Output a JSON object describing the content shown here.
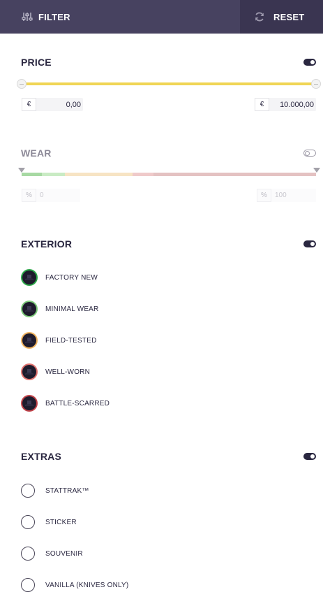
{
  "header": {
    "filter_label": "FILTER",
    "reset_label": "RESET",
    "filter_icon": "sliders-icon",
    "reset_icon": "refresh-icon"
  },
  "price": {
    "title": "PRICE",
    "enabled": true,
    "currency": "€",
    "min_value": "0,00",
    "max_value": "10.000,00",
    "track_color": "#f0d555"
  },
  "wear": {
    "title": "WEAR",
    "enabled": false,
    "percent_symbol": "%",
    "min_value": "0",
    "max_value": "100",
    "segments": [
      {
        "name": "factory-new",
        "color": "#a7d9a3"
      },
      {
        "name": "minimal-wear",
        "color": "#c9ebc4"
      },
      {
        "name": "field-tested",
        "color": "#f7e4c4"
      },
      {
        "name": "well-worn",
        "color": "#efcaca"
      },
      {
        "name": "battle-scarred",
        "color": "#e4c2c2"
      }
    ]
  },
  "exterior": {
    "title": "EXTERIOR",
    "enabled": true,
    "items": [
      {
        "label": "FACTORY NEW",
        "color": "#2ea84a",
        "icon": "top-hat-icon"
      },
      {
        "label": "MINIMAL WEAR",
        "color": "#7dc97a",
        "icon": "top-hat-icon"
      },
      {
        "label": "FIELD-TESTED",
        "color": "#f0b35e",
        "icon": "top-hat-icon"
      },
      {
        "label": "WELL-WORN",
        "color": "#e0726f",
        "icon": "top-hat-icon"
      },
      {
        "label": "BATTLE-SCARRED",
        "color": "#c2434a",
        "icon": "top-hat-icon"
      }
    ]
  },
  "extras": {
    "title": "EXTRAS",
    "enabled": true,
    "items": [
      {
        "label": "STATTRAK™"
      },
      {
        "label": "STICKER"
      },
      {
        "label": "SOUVENIR"
      },
      {
        "label": "VANILLA (KNIVES ONLY)"
      }
    ]
  }
}
